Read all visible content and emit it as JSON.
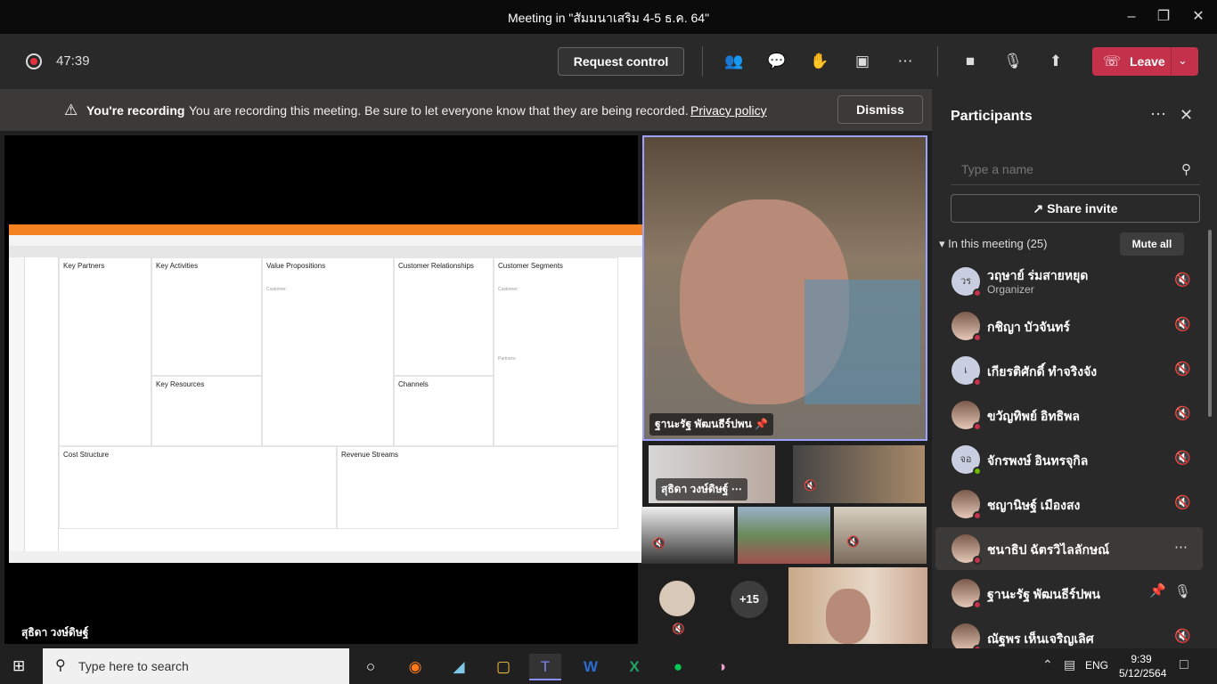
{
  "window": {
    "title": "Meeting in \"สัมมนาเสริม 4-5 ธ.ค. 64\""
  },
  "toolbar": {
    "timer": "47:39",
    "request_control": "Request control",
    "leave": "Leave"
  },
  "banner": {
    "bold": "You're recording",
    "message": "You are recording this meeting. Be sure to let everyone know that they are being recorded.",
    "link": "Privacy policy",
    "dismiss": "Dismiss"
  },
  "stage": {
    "share_name": "สุธิดา วงษ์ดิษฐ์",
    "main_video_name": "ฐานะรัฐ พัฒนธีร์ปพน",
    "tile2_name": "สุธิดา วงษ์ดิษฐ์",
    "overflow_count": "+15"
  },
  "pdf": {
    "cells": {
      "key_partners": "Key Partners",
      "key_activities": "Key Activities",
      "value_propositions": "Value Propositions",
      "customer_relationships": "Customer Relationships",
      "customer_segments": "Customer Segments",
      "key_resources": "Key Resources",
      "channels": "Channels",
      "cost_structure": "Cost Structure",
      "revenue_streams": "Revenue Streams"
    },
    "partners_label": "Partners:",
    "customer_label": "Customer:"
  },
  "panel": {
    "title": "Participants",
    "search_placeholder": "Type a name",
    "share_invite": "Share invite",
    "in_meeting": "In this meeting (25)",
    "mute_all": "Mute all",
    "participants": [
      {
        "name": "วฤษาย์ ร่มสายหยุด",
        "role": "Organizer",
        "initials": "วร"
      },
      {
        "name": "กชิญา บัวจันทร์",
        "role": "",
        "initials": ""
      },
      {
        "name": "เกียรติศักดิ์ ทำจริงจัง",
        "role": "",
        "initials": "เ"
      },
      {
        "name": "ขวัญทิพย์ อิทธิพล",
        "role": "",
        "initials": ""
      },
      {
        "name": "จักรพงษ์ อินทรจุกิล",
        "role": "",
        "initials": "จอ"
      },
      {
        "name": "ชญานิษฐ์ เมืองสง",
        "role": "",
        "initials": ""
      },
      {
        "name": "ชนาธิป ฉัตรวิไลลักษณ์",
        "role": "",
        "initials": ""
      },
      {
        "name": "ฐานะรัฐ พัฒนธีร์ปพน",
        "role": "",
        "initials": ""
      },
      {
        "name": "ณัฐพร เห็นเจริญเลิศ",
        "role": "",
        "initials": ""
      }
    ]
  },
  "taskbar": {
    "search_text": "Type here to search",
    "lang": "ENG",
    "time": "9:39",
    "date": "5/12/2564"
  }
}
